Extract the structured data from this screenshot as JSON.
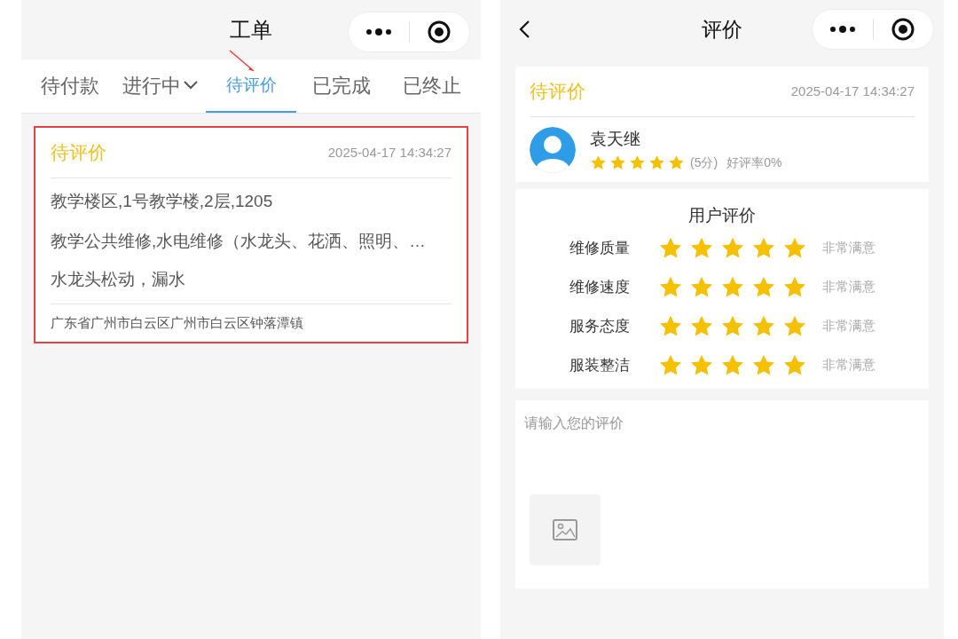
{
  "left": {
    "title": "工单",
    "tabs": [
      {
        "label": "待付款",
        "selected": false,
        "dropdown": false
      },
      {
        "label": "进行中",
        "selected": false,
        "dropdown": true
      },
      {
        "label": "待评价",
        "selected": true,
        "dropdown": false
      },
      {
        "label": "已完成",
        "selected": false,
        "dropdown": false
      },
      {
        "label": "已终止",
        "selected": false,
        "dropdown": false
      }
    ],
    "order": {
      "status": "待评价",
      "time": "2025-04-17 14:34:27",
      "location": "教学楼区,1号教学楼,2层,1205",
      "category": "教学公共维修,水电维修（水龙头、花洒、照明、…",
      "description": "水龙头松动，漏水",
      "address": "广东省广州市白云区广州市白云区钟落潭镇",
      "highlighted": true
    }
  },
  "right": {
    "title": "评价",
    "order": {
      "status": "待评价",
      "time": "2025-04-17 14:34:27"
    },
    "worker": {
      "name": "袁天继",
      "stars": 5,
      "score": "(5分)",
      "rate": "好评率0%"
    },
    "ratings_title": "用户评价",
    "ratings": [
      {
        "label": "维修质量",
        "stars": 5,
        "verdict": "非常满意"
      },
      {
        "label": "维修速度",
        "stars": 5,
        "verdict": "非常满意"
      },
      {
        "label": "服务态度",
        "stars": 5,
        "verdict": "非常满意"
      },
      {
        "label": "服装整洁",
        "stars": 5,
        "verdict": "非常满意"
      }
    ],
    "comment": {
      "placeholder": "请输入您的评价"
    }
  }
}
